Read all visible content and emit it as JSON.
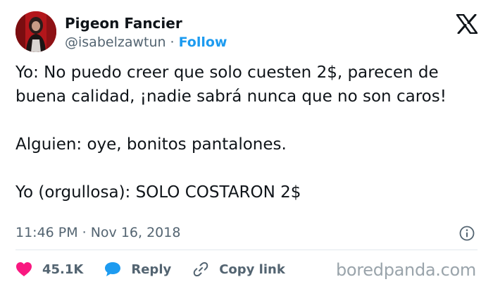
{
  "user": {
    "name": "Pigeon Fancier",
    "handle": "@isabelzawtun",
    "separator": "·",
    "follow_label": "Follow"
  },
  "tweet": {
    "lines": [
      "Yo: No puedo creer que solo cuesten 2$, parecen de",
      "buena calidad, ¡nadie sabrá nunca que no son caros!",
      "Alguien: oye, bonitos pantalones.",
      "Yo (orgullosa): SOLO COSTARON 2$"
    ],
    "time": "11:46 PM",
    "separator": "·",
    "date": "Nov 16, 2018"
  },
  "actions": {
    "likes": "45.1K",
    "reply_label": "Reply",
    "copy_link_label": "Copy link"
  },
  "watermark": "boredpanda.com",
  "icons": {
    "brand": "x-logo-icon",
    "info": "info-icon",
    "like": "heart-icon",
    "reply": "speech-bubble-icon",
    "copy": "link-icon"
  },
  "colors": {
    "follow": "#1d9bf0",
    "heart": "#f91880",
    "reply_bubble": "#1d9bf0",
    "muted": "#536471",
    "text": "#0f1419"
  }
}
